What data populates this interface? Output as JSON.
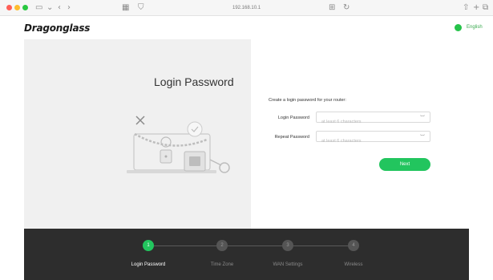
{
  "browser": {
    "url": "192.168.10.1"
  },
  "header": {
    "logo": "Dragonglass",
    "language": "English"
  },
  "left_panel": {
    "title": "Login Password"
  },
  "form": {
    "intro": "Create a login password for your router:",
    "login_password_label": "Login Password",
    "login_password_placeholder": "at least 6 characters",
    "repeat_password_label": "Repeat Password",
    "repeat_password_placeholder": "at least 6 characters",
    "next_label": "Next"
  },
  "steps": [
    {
      "number": "1",
      "label": "Login Password",
      "active": true
    },
    {
      "number": "2",
      "label": "Time Zone",
      "active": false
    },
    {
      "number": "3",
      "label": "WAN Settings",
      "active": false
    },
    {
      "number": "4",
      "label": "Wireless",
      "active": false
    }
  ],
  "colors": {
    "accent": "#22c55e",
    "footer": "#2d2d2d",
    "panel": "#f0f0f0"
  }
}
